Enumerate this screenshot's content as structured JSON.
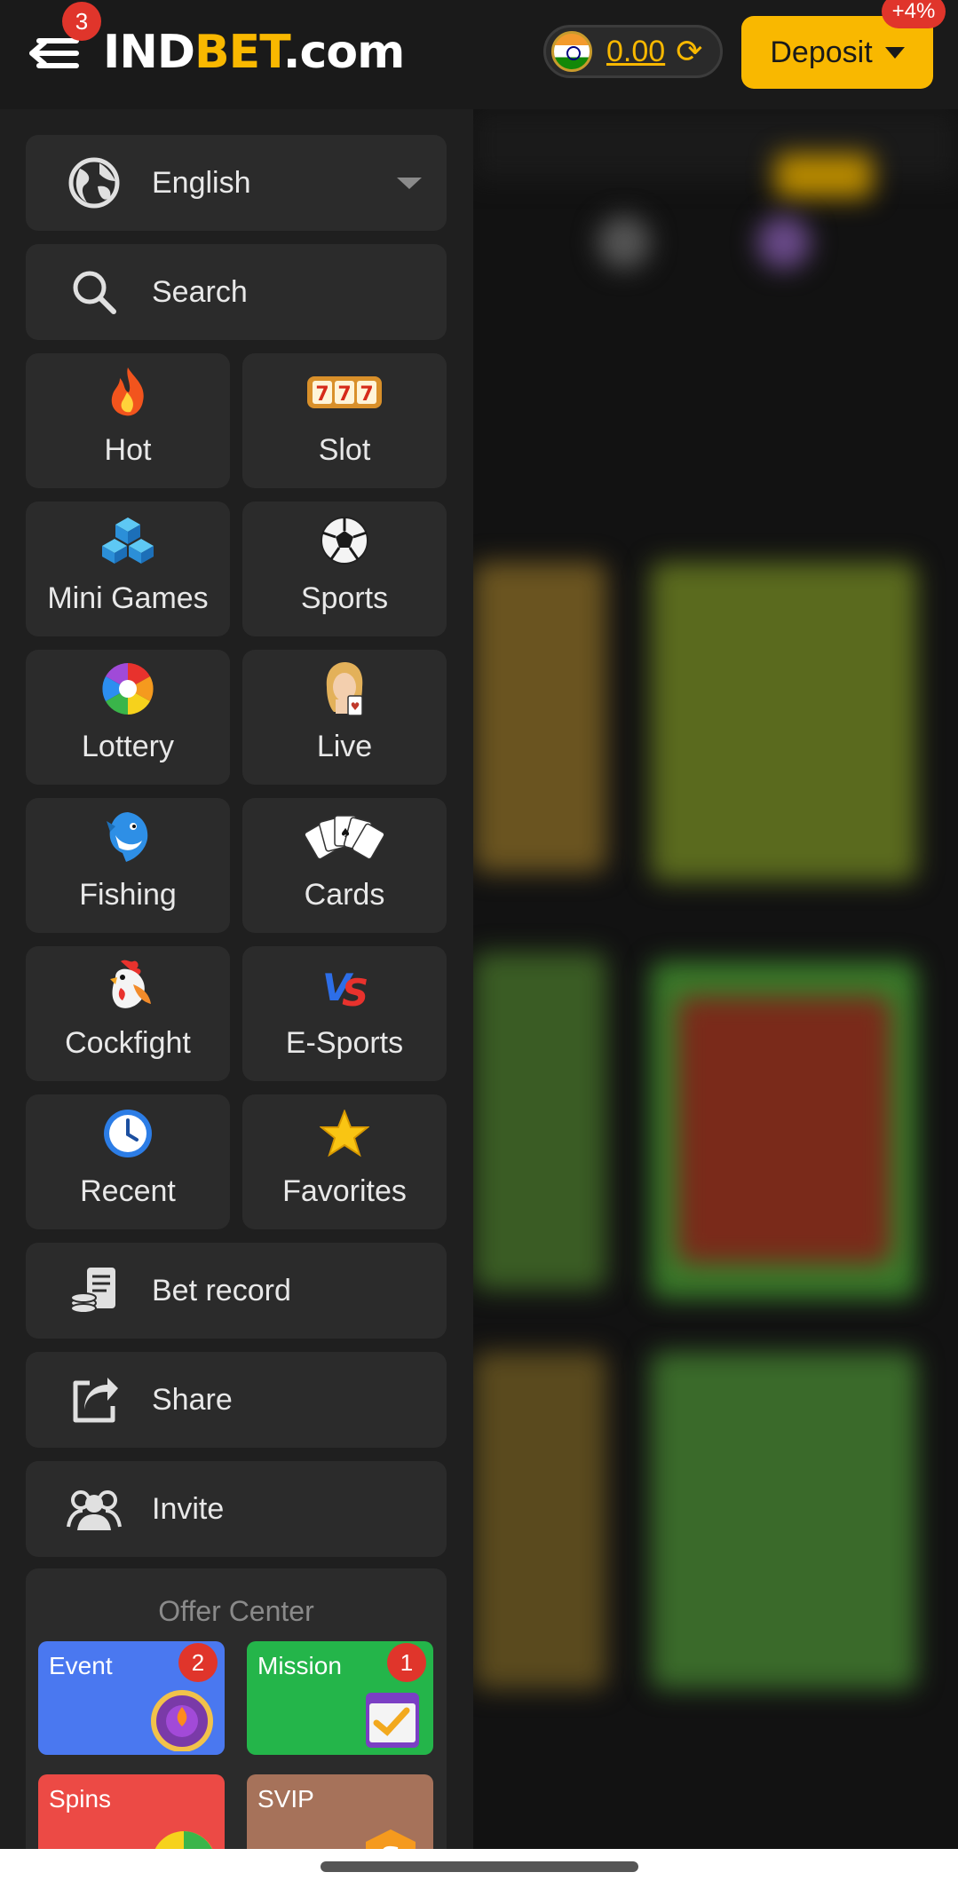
{
  "header": {
    "menu_badge": "3",
    "logo_part1": "IND",
    "logo_part2": "BET",
    "logo_part3": ".com",
    "balance": "0.00",
    "deposit_label": "Deposit",
    "deposit_bonus": "+4%"
  },
  "drawer": {
    "language": "English",
    "search_label": "Search",
    "categories": [
      {
        "label": "Hot",
        "icon": "flame-icon"
      },
      {
        "label": "Slot",
        "icon": "slot-777-icon"
      },
      {
        "label": "Mini Games",
        "icon": "blocks-icon"
      },
      {
        "label": "Sports",
        "icon": "soccer-ball-icon"
      },
      {
        "label": "Lottery",
        "icon": "lottery-wheel-icon"
      },
      {
        "label": "Live",
        "icon": "dealer-icon"
      },
      {
        "label": "Fishing",
        "icon": "shark-icon"
      },
      {
        "label": "Cards",
        "icon": "playing-cards-icon"
      },
      {
        "label": "Cockfight",
        "icon": "rooster-icon"
      },
      {
        "label": "E-Sports",
        "icon": "versus-icon"
      },
      {
        "label": "Recent",
        "icon": "clock-icon"
      },
      {
        "label": "Favorites",
        "icon": "star-icon"
      }
    ],
    "bet_record_label": "Bet record",
    "share_label": "Share",
    "invite_label": "Invite",
    "offer_center": {
      "title": "Offer Center",
      "cards": [
        {
          "label": "Event",
          "badge": "2",
          "color": "#4a78f0"
        },
        {
          "label": "Mission",
          "badge": "1",
          "color": "#24b54a"
        },
        {
          "label": "Spins",
          "badge": "",
          "color": "#ec4a45"
        },
        {
          "label": "SVIP",
          "badge": "",
          "color": "#a6725a"
        }
      ]
    }
  },
  "colors": {
    "accent": "#f9b800",
    "badge": "#e0352b",
    "drawer_bg": "#1f1f1f",
    "item_bg": "#2b2b2b"
  }
}
